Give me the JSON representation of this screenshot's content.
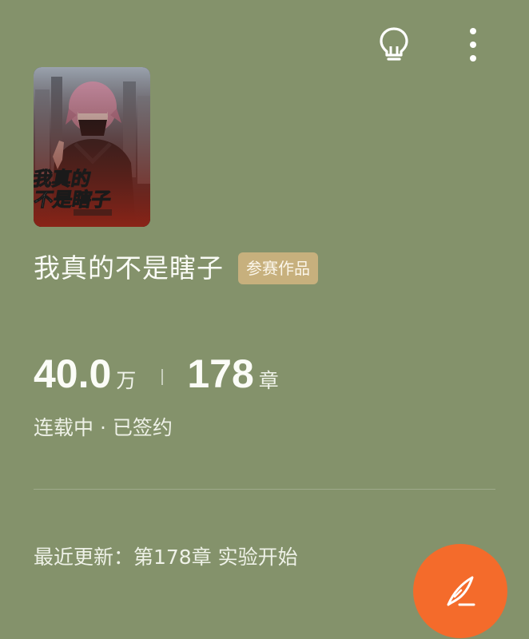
{
  "icons": {
    "tip": "lightbulb-icon",
    "menu": "more-vertical-icon",
    "write": "quill-pen-icon"
  },
  "book": {
    "cover_title": "我真的不是瞎子",
    "title": "我真的不是瞎子",
    "badge": "参赛作品",
    "word_count": "40.0",
    "word_unit": "万",
    "chapter_count": "178",
    "chapter_unit": "章",
    "status": "连载中 · 已签约",
    "latest_update": "最近更新：第178章 实验开始"
  },
  "colors": {
    "background": "#84926b",
    "badge": "#c7b07d",
    "fab": "#f46b2b"
  }
}
